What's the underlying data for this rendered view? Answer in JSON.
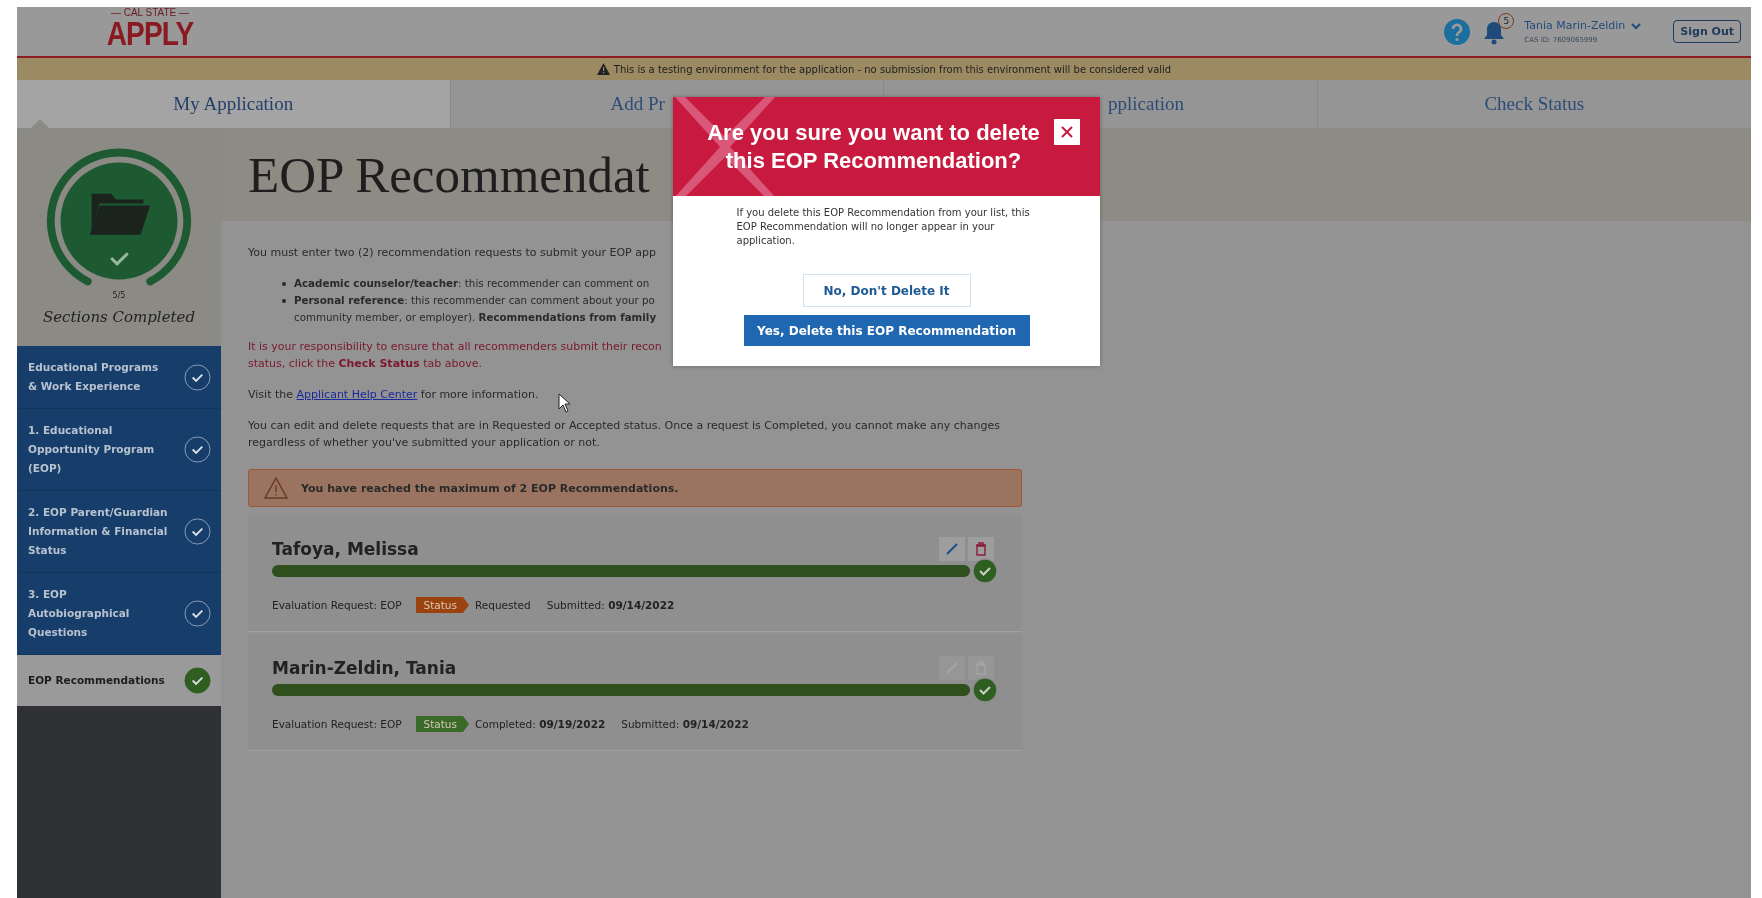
{
  "header": {
    "logo_top": "— CAL STATE —",
    "logo": "APPLY",
    "notification_count": "5",
    "user_name": "Tania Marin-Zeldin",
    "cas_id": "CAS ID: 7609065999",
    "sign_out": "Sign Out"
  },
  "banner": "This is a testing environment for the application - no submission from this environment will be considered valid",
  "nav_tabs": [
    {
      "label": "My Application",
      "selected": true
    },
    {
      "label": "Add Pr",
      "selected": false
    },
    {
      "label": "pplication",
      "selected": false
    },
    {
      "label": "Check Status",
      "selected": false
    }
  ],
  "sidebar": {
    "progress": "5/5",
    "progress_label": "Sections Completed",
    "items": [
      {
        "label": "Educational Programs & Work Experience",
        "selected": false
      },
      {
        "label": "1. Educational Opportunity Program (EOP)",
        "selected": false
      },
      {
        "label": "2. EOP Parent/Guardian Information & Financial Status",
        "selected": false
      },
      {
        "label": "3. EOP Autobiographical Questions",
        "selected": false
      },
      {
        "label": "EOP Recommendations",
        "selected": true
      }
    ]
  },
  "page": {
    "title": "EOP Recommendat",
    "intro": "You must enter two (2) recommendation requests to submit your EOP app",
    "bullets": [
      [
        "**Academic counselor/teacher**: this recommender can comment on"
      ],
      [
        "**Personal reference**: this recommender can comment about your po",
        "community member, or employer). **Recommendations from family**"
      ]
    ],
    "notice": [
      "It is your responsibility to ensure that all recommenders submit their recon",
      "status, click the **Check Status** tab above."
    ],
    "help": {
      "before": "Visit the",
      "link": "Applicant Help Center",
      "after": "for more information."
    },
    "edit_note": "You can edit and delete requests that are in Requested or Accepted status. Once a request is Completed, you cannot make any changes regardless of whether you've submitted your application or not.",
    "warning": "You have reached the maximum of 2 EOP Recommendations."
  },
  "recommendations": [
    {
      "name": "Tafoya, Melissa",
      "level": 1,
      "disabled": false,
      "evaluation": "Evaluation Request: EOP",
      "status_label": "Status",
      "color": "#9a430f",
      "status_text": "Requested",
      "submitted_label": "Submitted:",
      "submitted": "09/14/2022"
    },
    {
      "name": "Marin-Zeldin, Tania",
      "level": 1,
      "disabled": true,
      "evaluation": "Evaluation Request: EOP",
      "status_label": "Status",
      "color": "#3a6a2a",
      "status_text": "Completed:",
      "status_date": "09/19/2022",
      "submitted_label": "Submitted:",
      "submitted": "09/14/2022"
    }
  ],
  "modal": {
    "title": "Are you sure you want to delete this EOP Recommendation?",
    "body": "If you delete this EOP Recommendation from your list, this EOP Recommendation will no longer appear in your application.",
    "cancel": "No, Don't Delete It",
    "confirm": "Yes, Delete this EOP Recommendation"
  }
}
